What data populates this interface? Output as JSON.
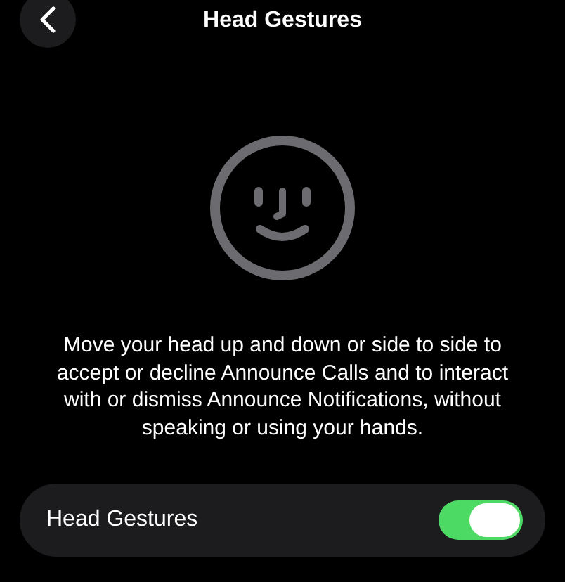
{
  "header": {
    "title": "Head Gestures"
  },
  "description": "Move your head up and down or side to side to accept or decline Announce Calls and to interact with or dismiss Announce Notifications, without speaking or using your hands.",
  "setting": {
    "label": "Head Gestures",
    "on": true
  }
}
